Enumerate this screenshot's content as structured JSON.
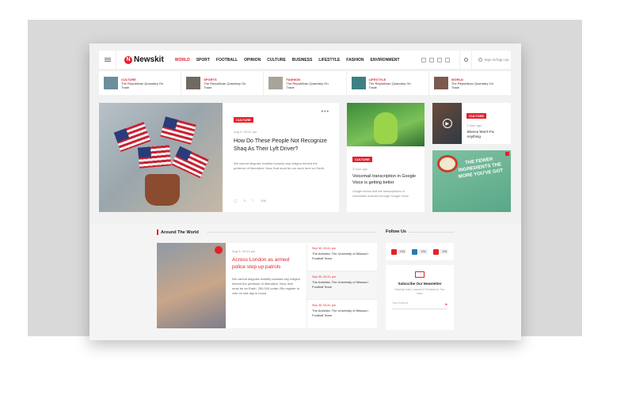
{
  "header": {
    "logo_text": "Newskit",
    "logo_mark": "N",
    "menu": [
      "WORLD",
      "SPORT",
      "FOOTBALL",
      "OPINION",
      "CULTURE",
      "BUSINESS",
      "LIFESTYLE",
      "FASHION",
      "ENVIRONMENT"
    ],
    "signin_label": "Sign In/Sign Up"
  },
  "ticker": [
    {
      "category": "CULTURE",
      "title": "The Republican Quandary On Trade"
    },
    {
      "category": "SPORTS",
      "title": "The Republican Quandary On Trade"
    },
    {
      "category": "FASHION",
      "title": "The Republican Quandary On Trade"
    },
    {
      "category": "LIFESTYLE",
      "title": "The Republican Quandary On Trade"
    },
    {
      "category": "WORLD",
      "title": "The Republican Quandary On Trade"
    }
  ],
  "hero": {
    "category": "CULTURE",
    "date": "Aug 5, 03:41 pm",
    "title": "How Do These People Not Recognize Shaq As Their Lyft Driver?",
    "description": "We cannot disguise hostility towards any religion behind the pretense of liberalism. Now, that must be our work here on Earth.",
    "comments": "3",
    "views": "936",
    "more": "•••"
  },
  "card_frog": {
    "category": "CULTURE",
    "date": "3 hour ago",
    "title": "Voicemail transcription in Google Voice is getting better",
    "description": "Google knows that the transcriptions of voicemails received through Google Voice."
  },
  "card_video": {
    "category": "CULTURE",
    "date": "3 hour ago",
    "title": "Silence Won't Fix Anything"
  },
  "ad": {
    "text": "THE FEWER INGREDIENTS THE MORE YOU'VE GOT"
  },
  "around": {
    "heading": "Around The World",
    "main": {
      "date": "Aug 5, 03:41 pm",
      "title": "Across London as armed police step up patrols",
      "description": "We cannot disguise hostility towards any religion behind the pretense of liberalism. Now, that must be an Earth. 250,000 under-25s register to vote on last day in boost"
    },
    "list": [
      {
        "date": "Sep 30, 03:41 pm",
        "title": "The Activists: The University of Missouri Football Team"
      },
      {
        "date": "Sep 30, 03:41 pm",
        "title": "The Activists: The University of Missouri Football Team"
      },
      {
        "date": "Sep 30, 03:41 pm",
        "title": "The Activists: The University of Missouri Football Team"
      }
    ]
  },
  "follow": {
    "heading": "Follow Us",
    "counts": [
      "134",
      "134",
      "134"
    ]
  },
  "newsletter": {
    "title": "Subscribe Our Newsletter",
    "description": "Keeping Gods, Lawyers & Freedoms to Your Inbox",
    "placeholder": "Your email id",
    "submit": "➔"
  },
  "colors": {
    "accent": "#e6202a"
  }
}
